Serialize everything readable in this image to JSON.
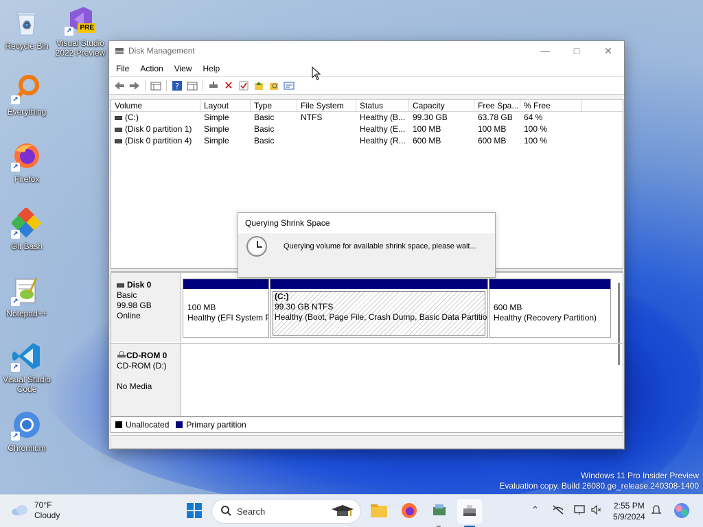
{
  "desktop": {
    "icons": [
      {
        "label": "Recycle Bin",
        "icon": "recycle-bin-icon"
      },
      {
        "label": "Visual Studio 2022 Preview",
        "icon": "visual-studio-preview-icon",
        "badge": "PRE"
      },
      {
        "label": "Everything",
        "icon": "everything-search-icon"
      },
      {
        "label": "Firefox",
        "icon": "firefox-icon"
      },
      {
        "label": "Git Bash",
        "icon": "git-bash-icon"
      },
      {
        "label": "Notepad++",
        "icon": "notepad-plus-plus-icon"
      },
      {
        "label": "Visual Studio Code",
        "icon": "vscode-icon"
      },
      {
        "label": "Chromium",
        "icon": "chromium-icon"
      }
    ],
    "watermark": {
      "line1": "Windows 11 Pro Insider Preview",
      "line2": "Evaluation copy. Build 26080.ge_release.240308-1400"
    }
  },
  "window": {
    "title": "Disk Management",
    "menu": [
      "File",
      "Action",
      "View",
      "Help"
    ],
    "columns": [
      "Volume",
      "Layout",
      "Type",
      "File System",
      "Status",
      "Capacity",
      "Free Spa...",
      "% Free"
    ],
    "volumes": [
      {
        "volume": "(C:)",
        "layout": "Simple",
        "type": "Basic",
        "fs": "NTFS",
        "status": "Healthy (B...",
        "capacity": "99.30 GB",
        "free": "63.78 GB",
        "pct": "64 %"
      },
      {
        "volume": "(Disk 0 partition 1)",
        "layout": "Simple",
        "type": "Basic",
        "fs": "",
        "status": "Healthy (E...",
        "capacity": "100 MB",
        "free": "100 MB",
        "pct": "100 %"
      },
      {
        "volume": "(Disk 0 partition 4)",
        "layout": "Simple",
        "type": "Basic",
        "fs": "",
        "status": "Healthy (R...",
        "capacity": "600 MB",
        "free": "600 MB",
        "pct": "100 %"
      }
    ],
    "disk0": {
      "name": "Disk 0",
      "type": "Basic",
      "size": "99.98 GB",
      "status": "Online",
      "partitions": [
        {
          "title": "",
          "size": "100 MB",
          "status": "Healthy (EFI System P"
        },
        {
          "title": "(C:)",
          "size": "99.30 GB NTFS",
          "status": "Healthy (Boot, Page File, Crash Dump, Basic Data Partition"
        },
        {
          "title": "",
          "size": "600 MB",
          "status": "Healthy (Recovery Partition)"
        }
      ]
    },
    "cdrom0": {
      "name": "CD-ROM 0",
      "drive": "CD-ROM (D:)",
      "media": "No Media"
    },
    "legend": {
      "unallocated": "Unallocated",
      "primary": "Primary partition",
      "unallocated_color": "#000000",
      "primary_color": "#00007f"
    }
  },
  "dialog": {
    "title": "Querying Shrink Space",
    "message": "Querying volume for available shrink space, please wait..."
  },
  "taskbar": {
    "weather": {
      "temp": "70°F",
      "condition": "Cloudy"
    },
    "search_label": "Search",
    "time": "2:55 PM",
    "date": "5/9/2024"
  }
}
